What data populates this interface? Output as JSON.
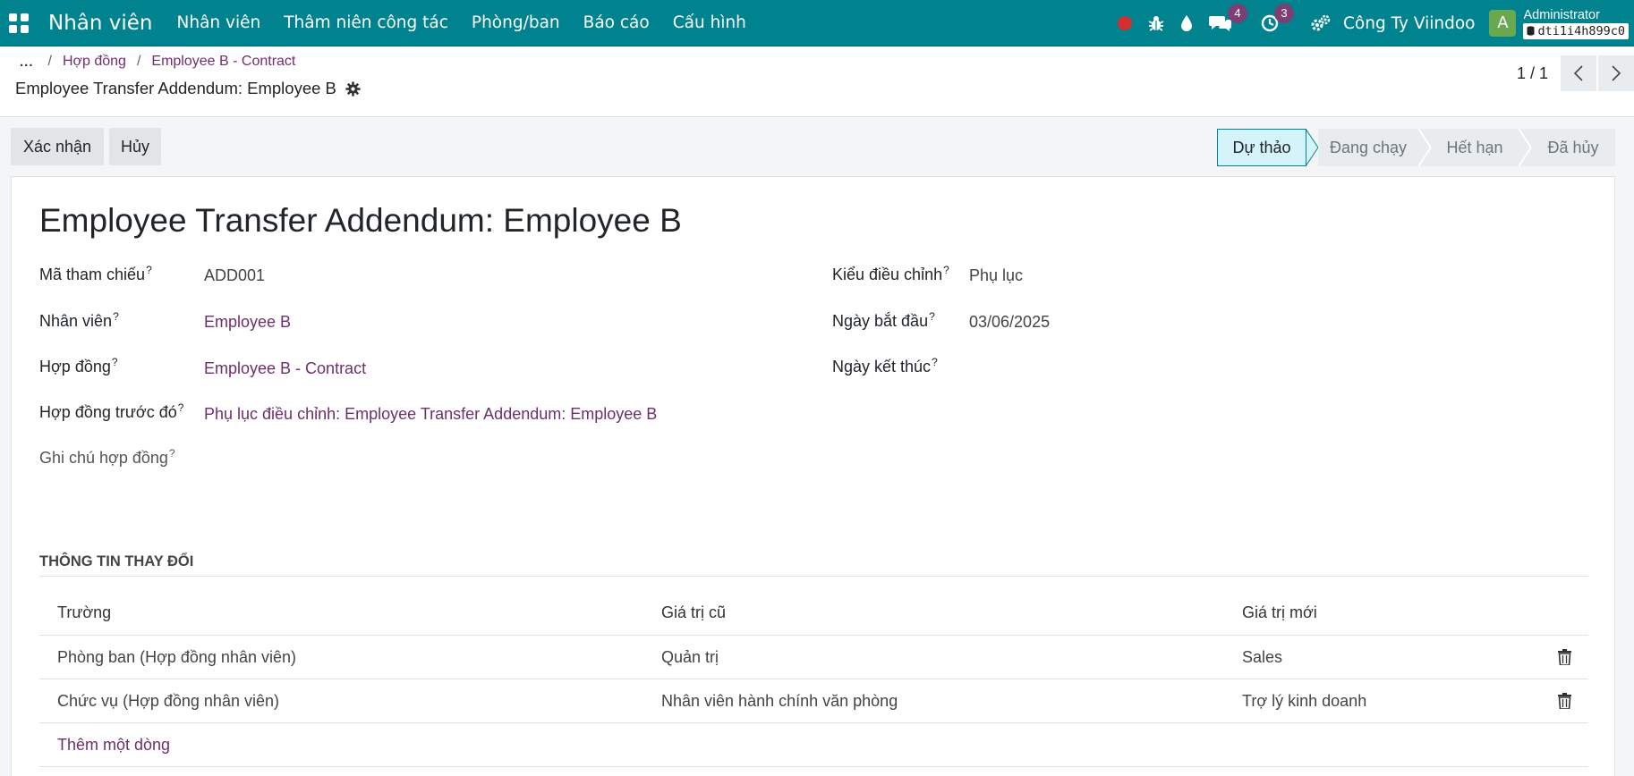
{
  "navbar": {
    "brand": "Nhân viên",
    "menu": [
      "Nhân viên",
      "Thâm niên công tác",
      "Phòng/ban",
      "Báo cáo",
      "Cấu hình"
    ],
    "messages_badge": "4",
    "activities_badge": "3",
    "company": "Công Ty Viindoo",
    "avatar_letter": "A",
    "user_name": "Administrator",
    "database": "dti1i4h899c0"
  },
  "breadcrumb": {
    "ellipsis": "...",
    "items": [
      "Hợp đồng",
      "Employee B - Contract"
    ],
    "current": "Employee Transfer Addendum: Employee B"
  },
  "pager": {
    "value": "1 / 1"
  },
  "actions": {
    "confirm": "Xác nhận",
    "cancel": "Hủy"
  },
  "statusbar": {
    "stages": [
      "Dự thảo",
      "Đang chạy",
      "Hết hạn",
      "Đã hủy"
    ],
    "active": "Dự thảo"
  },
  "form": {
    "title": "Employee Transfer Addendum: Employee B",
    "tooltip_mark": "?",
    "left_fields": [
      {
        "label": "Mã tham chiếu",
        "value": "ADD001"
      },
      {
        "label": "Nhân viên",
        "value": "Employee B"
      },
      {
        "label": "Hợp đồng",
        "value": "Employee B - Contract"
      },
      {
        "label": "Hợp đồng trước đó",
        "value": "Phụ lục điều chỉnh: Employee Transfer Addendum: Employee B"
      },
      {
        "label": "Ghi chú hợp đồng",
        "value": ""
      }
    ],
    "right_fields": [
      {
        "label": "Kiểu điều chỉnh",
        "value": "Phụ lục"
      },
      {
        "label": "Ngày bắt đầu",
        "value": "03/06/2025"
      },
      {
        "label": "Ngày kết thúc",
        "value": ""
      }
    ]
  },
  "changes": {
    "section_title": "THÔNG TIN THAY ĐỔI",
    "columns": [
      "Trường",
      "Giá trị cũ",
      "Giá trị mới"
    ],
    "rows": [
      [
        "Phòng ban (Hợp đồng nhân viên)",
        "Quản trị",
        "Sales"
      ],
      [
        "Chức vụ (Hợp đồng nhân viên)",
        "Nhân viên hành chính văn phòng",
        "Trợ lý kinh doanh"
      ]
    ],
    "add_line": "Thêm một dòng"
  },
  "colors": {
    "navbar": "#00838f",
    "link": "#6f2f6b",
    "active_stage": "#d4f4f9",
    "badge": "#7b3f73",
    "record_dot": "#d32f2f"
  },
  "icons": [
    "apps-grid-icon",
    "bug-icon",
    "drop-icon",
    "chat-icon",
    "clock-icon",
    "gears-icon",
    "gear-icon",
    "database-icon",
    "chevron-left-icon",
    "chevron-right-icon",
    "trash-icon"
  ]
}
